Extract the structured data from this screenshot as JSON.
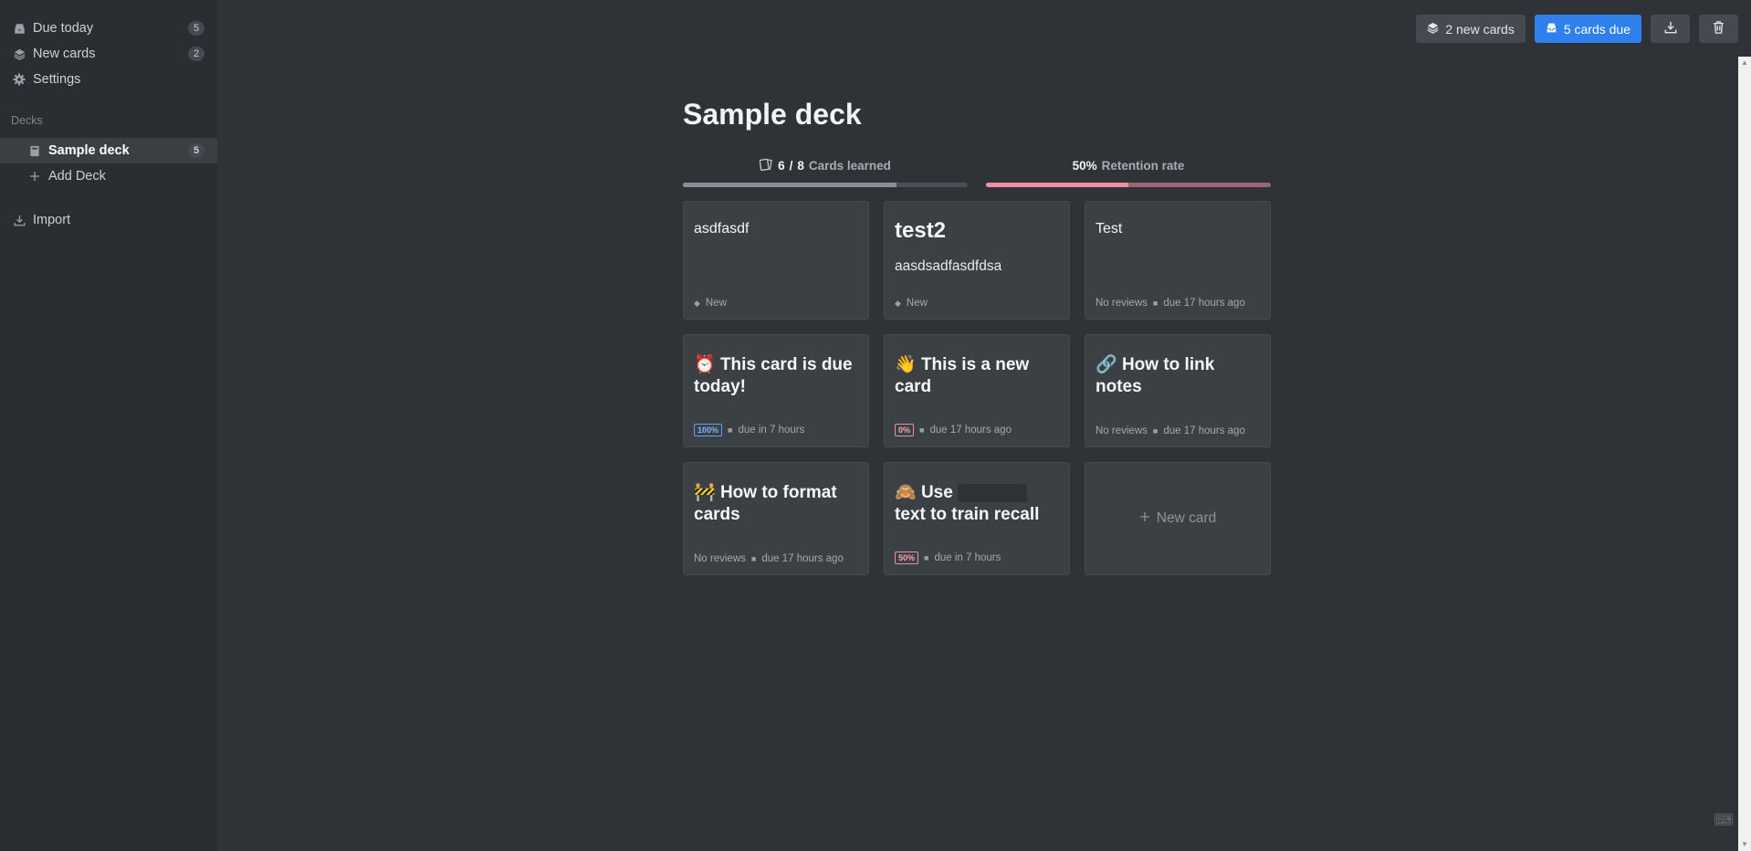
{
  "sidebar": {
    "nav": [
      {
        "label": "Due today",
        "count": "5",
        "icon": "inbox-icon"
      },
      {
        "label": "New cards",
        "count": "2",
        "icon": "layers-icon"
      },
      {
        "label": "Settings",
        "count": "",
        "icon": "gear-icon"
      }
    ],
    "decks_label": "Decks",
    "decks": [
      {
        "label": "Sample deck",
        "count": "5",
        "icon": "book-icon"
      }
    ],
    "add_deck_label": "Add Deck",
    "import_label": "Import"
  },
  "toolbar": {
    "new_cards_label": "2 new cards",
    "due_label": "5 cards due",
    "download_icon": "download-icon",
    "delete_icon": "trash-icon"
  },
  "main": {
    "title": "Sample deck",
    "learned": {
      "done": "6",
      "sep": "/",
      "total": "8",
      "label": "Cards learned",
      "fraction": 0.75
    },
    "retention": {
      "value": "50%",
      "label": "Retention rate",
      "fraction": 0.5
    },
    "cards": [
      {
        "title": "asdfasdf",
        "meta": "New"
      },
      {
        "title": "test2",
        "sub": "aasdsadfasdfdsa",
        "meta": "New"
      },
      {
        "title": "Test",
        "meta1": "No reviews",
        "meta2": "due 17 hours ago"
      },
      {
        "emoji": "⏰",
        "title": "This card is due today!",
        "badge": "100%",
        "meta": "due in 7 hours"
      },
      {
        "emoji": "👋",
        "title": "This is a new card",
        "badge": "0%",
        "meta": "due 17 hours ago"
      },
      {
        "emoji": "🔗",
        "title": "How to link notes",
        "meta1": "No reviews",
        "meta2": "due 17 hours ago"
      },
      {
        "emoji": "🚧",
        "title": "How to format cards",
        "meta1": "No reviews",
        "meta2": "due 17 hours ago"
      },
      {
        "emoji": "🙈",
        "title_a": "Use",
        "title_b": "text to train recall",
        "badge": "50%",
        "meta": "due in 7 hours"
      }
    ],
    "new_card_label": "New card"
  }
}
